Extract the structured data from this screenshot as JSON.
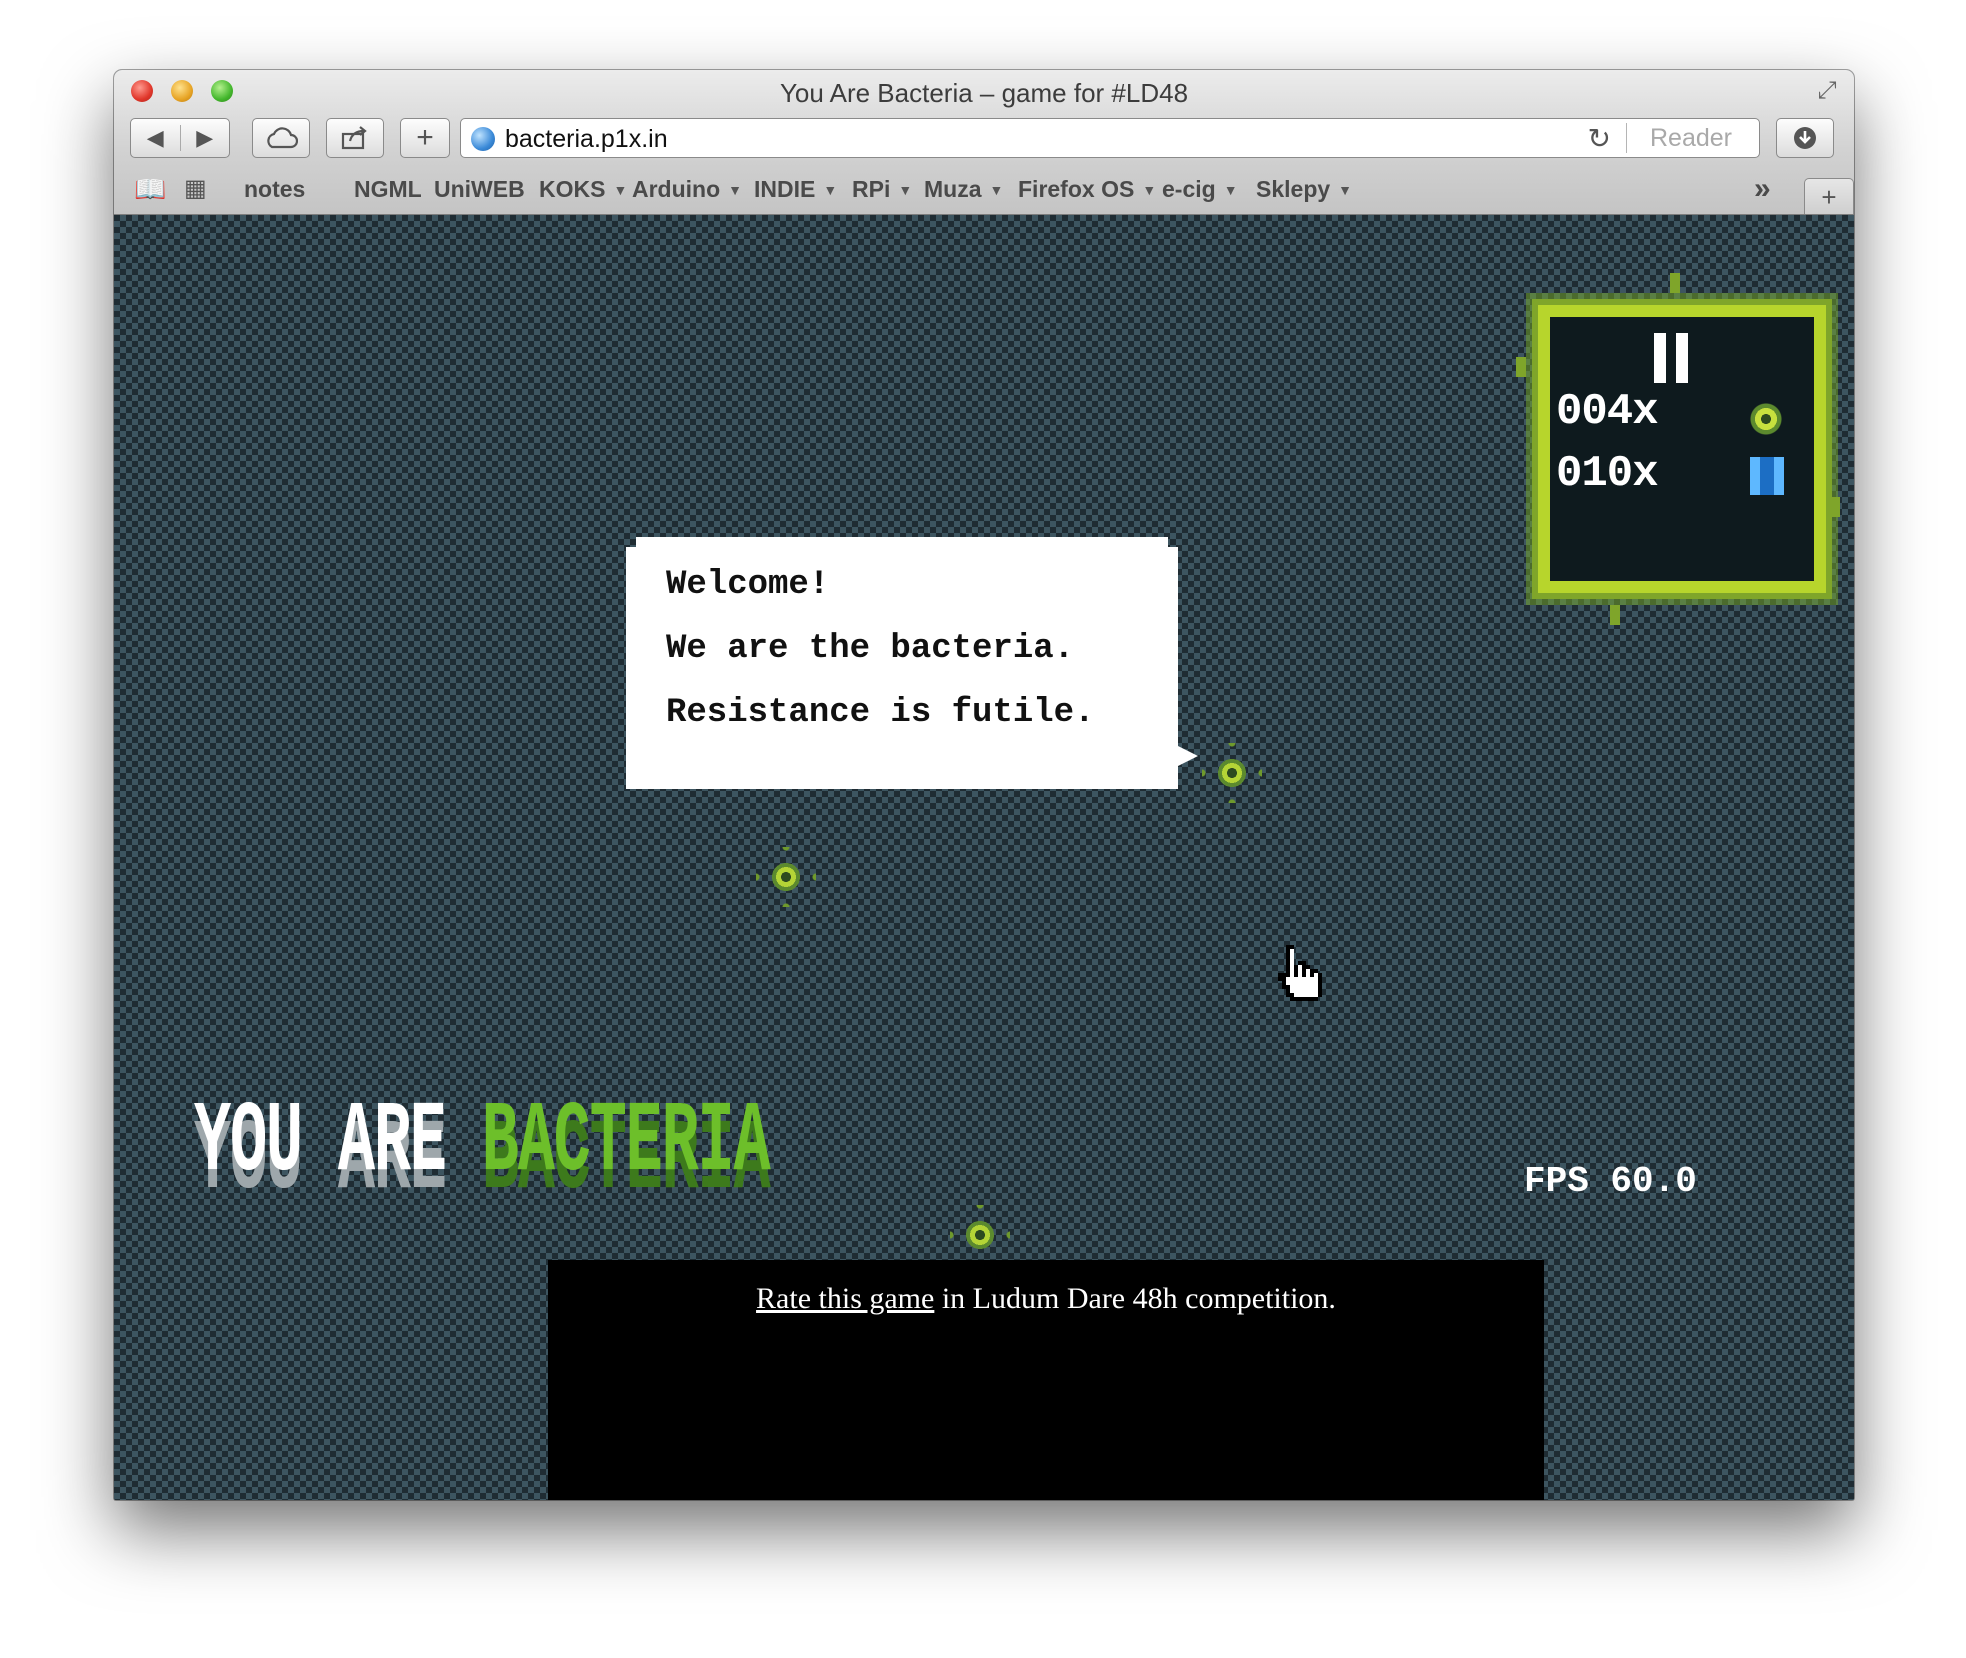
{
  "window": {
    "title": "You Are Bacteria – game for #LD48"
  },
  "toolbar": {
    "back": "◀",
    "forward": "▶",
    "new_tab": "+",
    "url": "bacteria.p1x.in",
    "reader": "Reader"
  },
  "bookmarks": {
    "items": [
      {
        "label": "notes",
        "has_menu": false
      },
      {
        "label": "NGML",
        "has_menu": false
      },
      {
        "label": "UniWEB",
        "has_menu": false
      },
      {
        "label": "KOKS",
        "has_menu": true
      },
      {
        "label": "Arduino",
        "has_menu": true
      },
      {
        "label": "INDIE",
        "has_menu": true
      },
      {
        "label": "RPi",
        "has_menu": true
      },
      {
        "label": "Muza",
        "has_menu": true
      },
      {
        "label": "Firefox OS",
        "has_menu": true
      },
      {
        "label": "e-cig",
        "has_menu": true
      },
      {
        "label": "Sklepy",
        "has_menu": true
      }
    ],
    "overflow": "»",
    "new_tab": "+"
  },
  "game": {
    "dialog": {
      "line1": "Welcome!",
      "line2": "We are the bacteria.",
      "line3": "Resistance is futile."
    },
    "hud": {
      "bacteria_count": "004x",
      "pill_count": "010x"
    },
    "logo": {
      "part1": "YOU ARE",
      "part2": "BACTERIA"
    },
    "fps": "FPS 60.0",
    "footer": {
      "link": "Rate this game",
      "text": " in Ludum Dare 48h competition."
    }
  },
  "colors": {
    "bacteria_green": "#b4d436",
    "hud_frame": "#b7d52c",
    "background_check": "#3d5560"
  }
}
